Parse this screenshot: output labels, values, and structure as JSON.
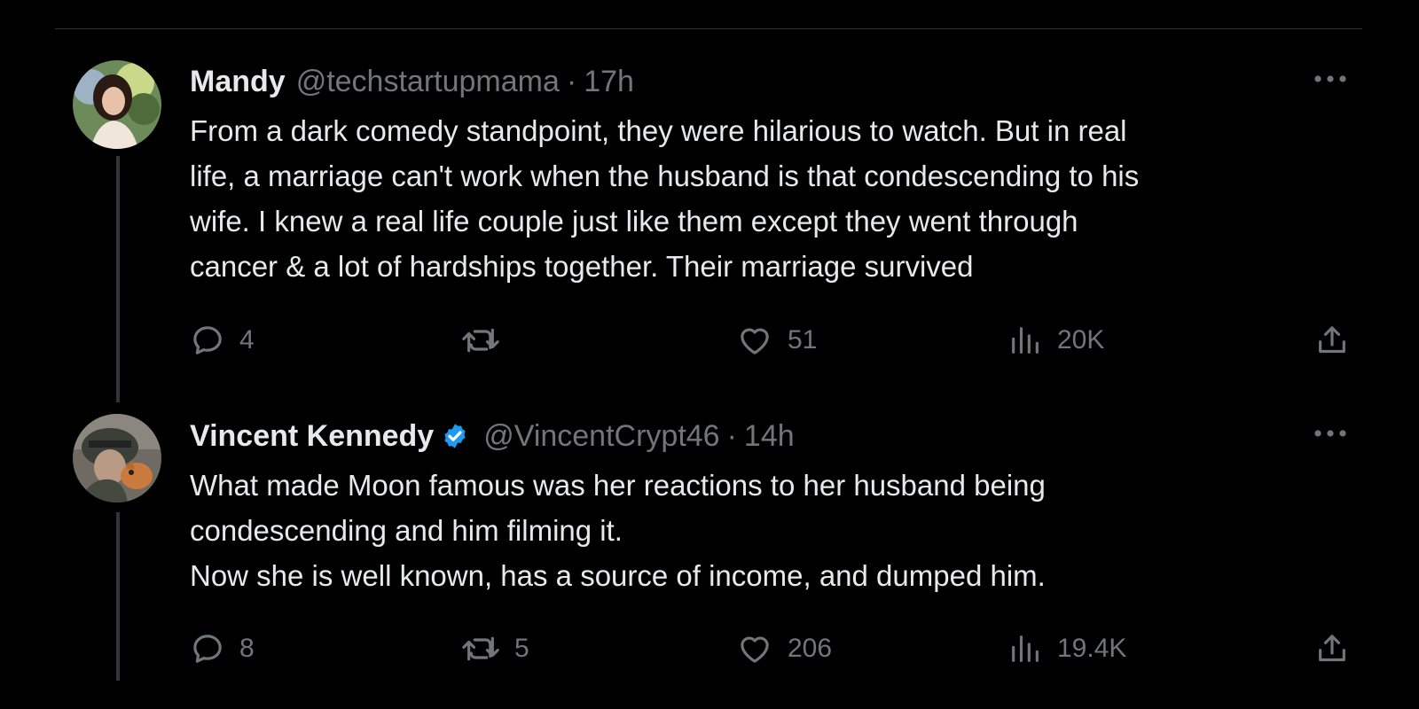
{
  "tweets": [
    {
      "name": "Mandy",
      "verified": false,
      "handle": "@techstartupmama",
      "separator": "·",
      "time": "17h",
      "text": "From a dark comedy standpoint, they were hilarious to watch. But in real\nlife, a marriage can't work when the husband is that condescending to his\nwife. I knew a real life couple just like them except they went through\ncancer & a lot of hardships together. Their marriage survived",
      "replies": "4",
      "retweets": "",
      "likes": "51",
      "views": "20K"
    },
    {
      "name": "Vincent Kennedy",
      "verified": true,
      "handle": "@VincentCrypt46",
      "separator": "·",
      "time": "14h",
      "text": "What made Moon famous was her reactions to her husband being\ncondescending and him filming it.\nNow she is well known, has a source of income, and dumped him.",
      "replies": "8",
      "retweets": "5",
      "likes": "206",
      "views": "19.4K"
    }
  ],
  "colors": {
    "background": "#000000",
    "text": "#e7e9ea",
    "muted": "#71767b",
    "verified": "#1d9bf0",
    "thread_line": "#333639"
  },
  "icons": {
    "more": "more-horizontal-icon",
    "reply": "reply-icon",
    "retweet": "retweet-icon",
    "like": "heart-icon",
    "views": "views-bar-chart-icon",
    "share": "share-icon",
    "verified": "verified-badge-icon"
  }
}
